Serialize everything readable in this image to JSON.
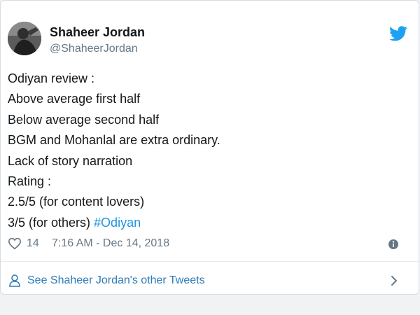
{
  "user": {
    "name": "Shaheer Jordan",
    "handle": "@ShaheerJordan"
  },
  "tweet": {
    "lines": [
      "Odiyan review :",
      "Above average first half",
      "Below average second half",
      "BGM and Mohanlal are extra ordinary.",
      "Lack of story narration",
      "Rating :",
      "2.5/5 (for content lovers)"
    ],
    "last_line_text": "3/5 (for others) ",
    "hashtag": "#Odiyan"
  },
  "meta": {
    "likes": "14",
    "timestamp": "7:16 AM - Dec 14, 2018"
  },
  "footer": {
    "link_text": "See Shaheer Jordan's other Tweets"
  },
  "colors": {
    "brand": "#1da1f2",
    "link": "#2b7bb9",
    "secondary_text": "#657786"
  },
  "icons": {
    "logo": "twitter-bird-icon",
    "like": "heart-icon",
    "info": "info-icon",
    "profile": "person-icon",
    "more": "chevron-right-icon"
  }
}
